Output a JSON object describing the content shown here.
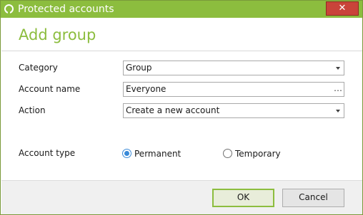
{
  "window": {
    "title": "Protected accounts",
    "close_label": "✕"
  },
  "dialog": {
    "heading": "Add group"
  },
  "form": {
    "category": {
      "label": "Category",
      "value": "Group"
    },
    "account_name": {
      "label": "Account name",
      "value": "Everyone",
      "browse_label": "…"
    },
    "action": {
      "label": "Action",
      "value": "Create a new account"
    },
    "account_type": {
      "label": "Account type",
      "options": [
        {
          "label": "Permanent",
          "selected": true
        },
        {
          "label": "Temporary",
          "selected": false
        }
      ]
    }
  },
  "footer": {
    "ok_label": "OK",
    "cancel_label": "Cancel"
  },
  "colors": {
    "accent": "#8cbd3e",
    "close": "#c9443a",
    "radio_selected": "#3a8ad8"
  }
}
